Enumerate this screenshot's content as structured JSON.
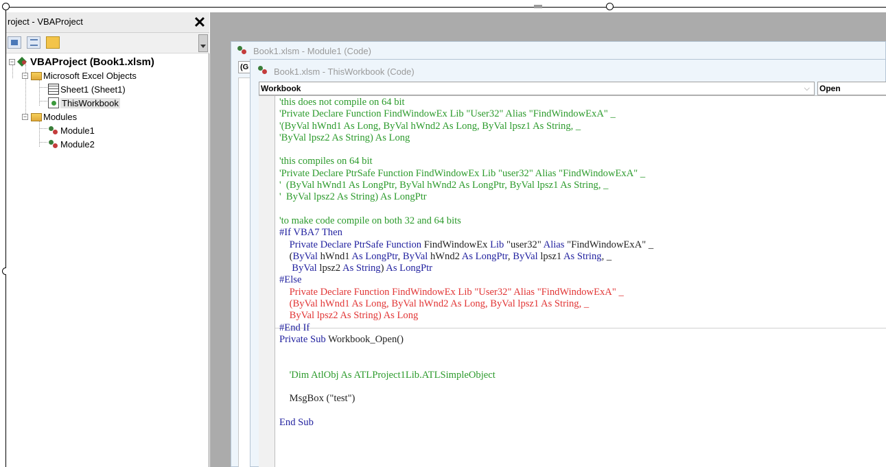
{
  "project_explorer": {
    "title": "roject - VBAProject",
    "close_glyph": "✕",
    "tree": {
      "project": "VBAProject (Book1.xlsm)",
      "excel_objects_folder": "Microsoft Excel Objects",
      "sheet1": "Sheet1 (Sheet1)",
      "this_workbook": "ThisWorkbook",
      "modules_folder": "Modules",
      "module1": "Module1",
      "module2": "Module2"
    }
  },
  "windows": {
    "module1": {
      "title": "Book1.xlsm - Module1 (Code)",
      "combo_fragment": "(G"
    },
    "this_workbook": {
      "title": "Book1.xlsm - ThisWorkbook (Code)",
      "object_combo": "Workbook",
      "procedure_combo": "Open"
    }
  },
  "code_lines": [
    [
      {
        "t": "'this does not compile on 64 bit",
        "c": "cmt"
      }
    ],
    [
      {
        "t": "'Private Declare Function FindWindowEx Lib \"User32\" Alias \"FindWindowExA\" _",
        "c": "cmt"
      }
    ],
    [
      {
        "t": "'(ByVal hWnd1 As Long, ByVal hWnd2 As Long, ByVal lpsz1 As String, _",
        "c": "cmt"
      }
    ],
    [
      {
        "t": "'ByVal lpsz2 As String) As Long",
        "c": "cmt"
      }
    ],
    [
      {
        "t": "",
        "c": "plain"
      }
    ],
    [
      {
        "t": "'this compiles on 64 bit",
        "c": "cmt"
      }
    ],
    [
      {
        "t": "'Private Declare PtrSafe Function FindWindowEx Lib \"user32\" Alias \"FindWindowExA\" _",
        "c": "cmt"
      }
    ],
    [
      {
        "t": "'  (ByVal hWnd1 As LongPtr, ByVal hWnd2 As LongPtr, ByVal lpsz1 As String, _",
        "c": "cmt"
      }
    ],
    [
      {
        "t": "'  ByVal lpsz2 As String) As LongPtr",
        "c": "cmt"
      }
    ],
    [
      {
        "t": "",
        "c": "plain"
      }
    ],
    [
      {
        "t": "'to make code compile on both 32 and 64 bits",
        "c": "cmt"
      }
    ],
    [
      {
        "t": "#If VBA7 Then",
        "c": "kw"
      }
    ],
    [
      {
        "t": "    Private Declare PtrSafe Function ",
        "c": "kw"
      },
      {
        "t": "FindWindowEx ",
        "c": "plain"
      },
      {
        "t": "Lib ",
        "c": "kw"
      },
      {
        "t": "\"user32\" ",
        "c": "plain"
      },
      {
        "t": "Alias ",
        "c": "kw"
      },
      {
        "t": "\"FindWindowExA\" _",
        "c": "plain"
      }
    ],
    [
      {
        "t": "    (",
        "c": "plain"
      },
      {
        "t": "ByVal ",
        "c": "kw"
      },
      {
        "t": "hWnd1 ",
        "c": "plain"
      },
      {
        "t": "As LongPtr",
        "c": "kw"
      },
      {
        "t": ", ",
        "c": "plain"
      },
      {
        "t": "ByVal ",
        "c": "kw"
      },
      {
        "t": "hWnd2 ",
        "c": "plain"
      },
      {
        "t": "As LongPtr",
        "c": "kw"
      },
      {
        "t": ", ",
        "c": "plain"
      },
      {
        "t": "ByVal ",
        "c": "kw"
      },
      {
        "t": "lpsz1 ",
        "c": "plain"
      },
      {
        "t": "As String",
        "c": "kw"
      },
      {
        "t": ", _",
        "c": "plain"
      }
    ],
    [
      {
        "t": "     ",
        "c": "plain"
      },
      {
        "t": "ByVal ",
        "c": "kw"
      },
      {
        "t": "lpsz2 ",
        "c": "plain"
      },
      {
        "t": "As String",
        "c": "kw"
      },
      {
        "t": ") ",
        "c": "plain"
      },
      {
        "t": "As LongPtr",
        "c": "kw"
      }
    ],
    [
      {
        "t": "#Else",
        "c": "kw"
      }
    ],
    [
      {
        "t": "    Private Declare Function FindWindowEx Lib \"User32\" Alias \"FindWindowExA\" _",
        "c": "red"
      }
    ],
    [
      {
        "t": "    (ByVal hWnd1 As Long, ByVal hWnd2 As Long, ByVal lpsz1 As String, _",
        "c": "red"
      }
    ],
    [
      {
        "t": "    ByVal lpsz2 As String) As Long",
        "c": "red"
      }
    ],
    [
      {
        "t": "#End If",
        "c": "kw"
      }
    ],
    [
      {
        "t": "Private Sub ",
        "c": "kw"
      },
      {
        "t": "Workbook_Open()",
        "c": "plain"
      }
    ],
    [
      {
        "t": "",
        "c": "plain"
      }
    ],
    [
      {
        "t": "",
        "c": "plain"
      }
    ],
    [
      {
        "t": "    'Dim AtlObj As ATLProject1Lib.ATLSimpleObject",
        "c": "cmt"
      }
    ],
    [
      {
        "t": "",
        "c": "plain"
      }
    ],
    [
      {
        "t": "    MsgBox (\"test\")",
        "c": "plain"
      }
    ],
    [
      {
        "t": "",
        "c": "plain"
      }
    ],
    [
      {
        "t": "End Sub",
        "c": "kw"
      }
    ]
  ],
  "colors": {
    "comment": "#2b9a2b",
    "keyword": "#1f1f9e",
    "error": "#e13434",
    "workspace": "#ababab"
  },
  "icons": [
    "vba-project-icon",
    "folder-icon",
    "sheet-icon",
    "workbook-icon",
    "module-icon",
    "close-icon"
  ]
}
